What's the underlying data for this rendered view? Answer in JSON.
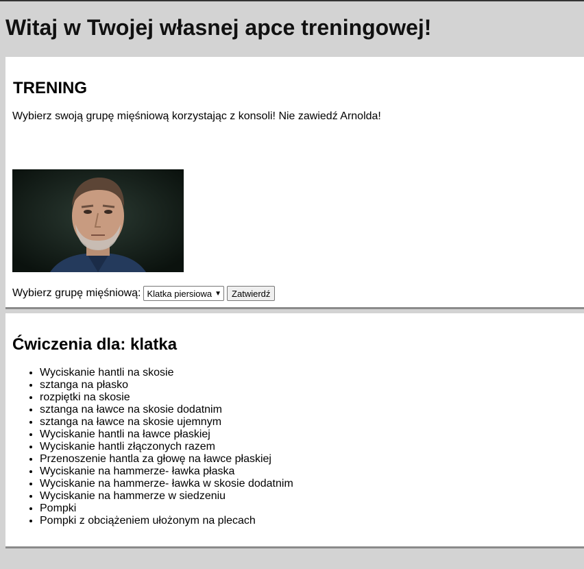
{
  "header": {
    "title": "Witaj w Twojej własnej apce treningowej!"
  },
  "training": {
    "title": "TRENING",
    "description": "Wybierz swoją grupę mięśniową korzystając z konsoli! Nie zawiedź Arnolda!",
    "image_alt": "Arnold",
    "form_label": "Wybierz grupę mięśniową:",
    "select_value": "Klatka piersiowa",
    "submit_label": "Zatwierdź"
  },
  "exercises": {
    "title": "Ćwiczenia dla: klatka",
    "items": [
      "Wyciskanie hantli na skosie",
      "sztanga na płasko",
      "rozpiętki na skosie",
      "sztanga na ławce na skosie dodatnim",
      "sztanga na ławce na skosie ujemnym",
      "Wyciskanie hantli na ławce płaskiej",
      "Wyciskanie hantli złączonych razem",
      "Przenoszenie hantla za głowę na ławce płaskiej",
      "Wyciskanie na hammerze- ławka płaska",
      "Wyciskanie na hammerze- ławka w skosie dodatnim",
      "Wyciskanie na hammerze w siedzeniu",
      "Pompki",
      "Pompki z obciążeniem ułożonym na plecach"
    ]
  }
}
